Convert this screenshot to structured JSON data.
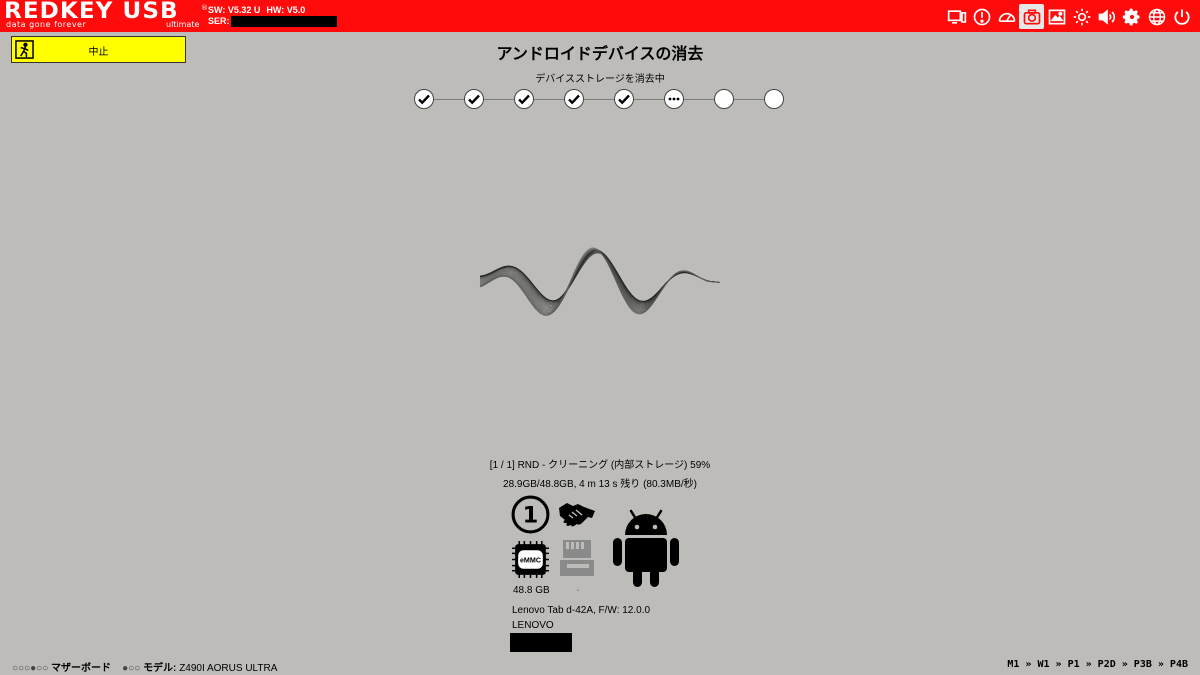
{
  "header": {
    "logo_main": "REDKEY USB",
    "logo_reg": "®",
    "logo_tagline": "data gone forever",
    "logo_edition": "ultimate",
    "sw_version": "SW: V5.32 U",
    "hw_version": "HW: V5.0",
    "serial_label": "SER:",
    "icons": [
      "monitor-icon",
      "alert-icon",
      "gauge-icon",
      "camera-icon",
      "screenshot-icon",
      "brightness-icon",
      "volume-icon",
      "settings-gear-icon",
      "globe-icon",
      "power-icon"
    ],
    "accent_color": "#ff0b0b"
  },
  "abort_button": {
    "label": "中止",
    "color": "#ffff00"
  },
  "main": {
    "title": "アンドロイドデバイスの消去",
    "step_label": "デバイスストレージを消去中",
    "steps": [
      "done",
      "done",
      "done",
      "done",
      "done",
      "in-progress",
      "pending",
      "pending"
    ]
  },
  "progress": {
    "line1": "[1 / 1] RND - クリーニング (内部ストレージ) 59%",
    "line2": "28.9GB/48.8GB, 4 m 13 s 残り (80.3MB/秒)",
    "percent": 59
  },
  "device": {
    "slot_number": "1",
    "chip_label": "eMMC",
    "capacity": "48.8 GB",
    "sd_capacity": "-",
    "model": "Lenovo Tab d-42A, F/W: 12.0.0",
    "manufacturer": "LENOVO"
  },
  "footer": {
    "left_dots1": "○○○●○○",
    "left_label1": "マザーボード",
    "left_dots2": "●○○",
    "left_label2": "モデル:",
    "left_value2": "Z490I AORUS ULTRA",
    "breadcrumb": "M1 » W1 » P1 » P2D » P3B » P4B"
  }
}
